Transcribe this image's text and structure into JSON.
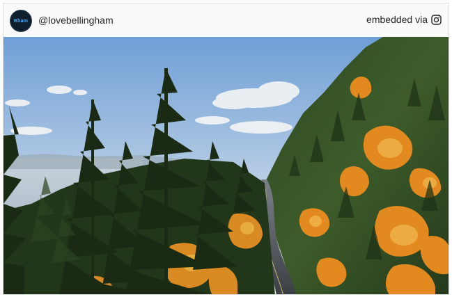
{
  "post": {
    "username": "@lovebellingham",
    "avatar_text": "Bham",
    "embedded_label": "embedded via",
    "embedded_icon": "instagram-icon"
  },
  "photo": {
    "alt": "Aerial view of a winding road through autumn forest"
  },
  "colors": {
    "card_bg": "#fafafa",
    "border": "#dfdfdf",
    "sky_top": "#7aa7d9",
    "sky_bottom": "#e7ecef",
    "autumn_orange": "#e28a1f",
    "evergreen": "#2f4a24"
  }
}
